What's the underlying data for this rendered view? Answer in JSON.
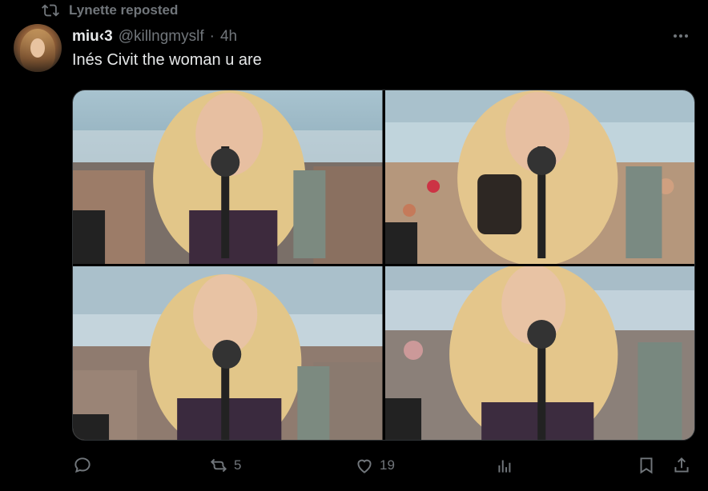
{
  "repost": {
    "label": "Lynette reposted",
    "icon": "repost-icon"
  },
  "author": {
    "display_name": "miu‹3",
    "handle": "@killngmyslf",
    "separator": "·",
    "time": "4h"
  },
  "tweet": {
    "text": "Inés Civit the woman u are"
  },
  "media": {
    "photos": [
      {
        "name": "photo-1"
      },
      {
        "name": "photo-2"
      },
      {
        "name": "photo-3"
      },
      {
        "name": "photo-4"
      }
    ]
  },
  "actions": {
    "reply": {
      "icon": "reply-icon",
      "count": ""
    },
    "retweet": {
      "icon": "retweet-icon",
      "count": "5"
    },
    "like": {
      "icon": "heart-icon",
      "count": "19"
    },
    "views": {
      "icon": "analytics-icon",
      "count": ""
    },
    "bookmark": {
      "icon": "bookmark-icon"
    },
    "share": {
      "icon": "share-icon"
    }
  },
  "colors": {
    "background": "#000000",
    "text": "#e7e9ea",
    "muted": "#71767b",
    "border": "#2f3336"
  }
}
